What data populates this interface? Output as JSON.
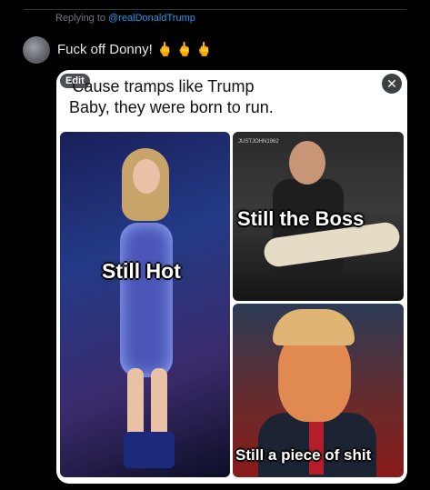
{
  "reply": {
    "prefix": "Replying to",
    "handle": "@realDonaldTrump"
  },
  "tweet": {
    "text": "Fuck off Donny!",
    "emoji": "🖕🖕🖕"
  },
  "media": {
    "edit_label": "Edit",
    "close_icon": "✕",
    "caption_line1": "'Cause tramps like Trump",
    "caption_line2": "Baby, they were born to run.",
    "panels": {
      "left_label": "Still Hot",
      "top_right_label": "Still the Boss",
      "top_right_watermark": "JUSTJOHN1962",
      "bottom_right_label": "Still a piece of shit"
    }
  }
}
